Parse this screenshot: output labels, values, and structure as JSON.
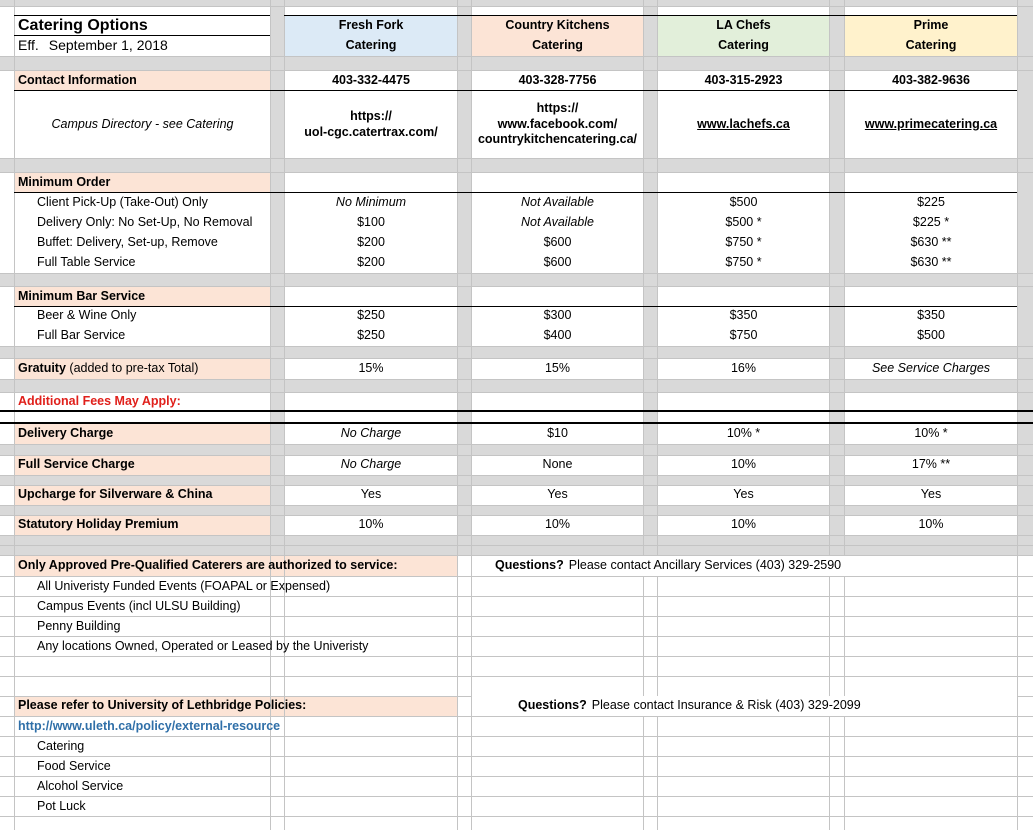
{
  "title": "Catering Options",
  "effective": {
    "label": "Eff.",
    "date": "September 1, 2018"
  },
  "vendors": [
    {
      "name": "Fresh Fork",
      "sub": "Catering"
    },
    {
      "name": "Country Kitchens",
      "sub": "Catering"
    },
    {
      "name": "LA Chefs",
      "sub": "Catering"
    },
    {
      "name": "Prime",
      "sub": "Catering"
    }
  ],
  "contact": {
    "label": "Contact Information",
    "phones": [
      "403-332-4475",
      "403-328-7756",
      "403-315-2923",
      "403-382-9636"
    ],
    "directory_note": "Campus Directory - see Catering",
    "web": {
      "fresh_fork_1": "https://",
      "fresh_fork_2": "uol-cgc.catertrax.com/",
      "country_1": "https://",
      "country_2": "www.facebook.com/",
      "country_3": "countrykitchencatering.ca/",
      "la_chefs": "www.lachefs.ca",
      "prime": "www.primecatering.ca"
    }
  },
  "minimum_order": {
    "label": "Minimum Order",
    "rows": [
      {
        "label": "Client Pick-Up (Take-Out) Only",
        "values": [
          "No Minimum",
          "Not Available",
          "$500",
          "$225"
        ]
      },
      {
        "label": "Delivery Only: No Set-Up, No Removal",
        "values": [
          "$100",
          "Not Available",
          "$500 *",
          "$225 *"
        ]
      },
      {
        "label": "Buffet: Delivery, Set-up, Remove",
        "values": [
          "$200",
          "$600",
          "$750 *",
          "$630 **"
        ]
      },
      {
        "label": "Full Table Service",
        "values": [
          "$200",
          "$600",
          "$750 *",
          "$630 **"
        ]
      }
    ]
  },
  "minimum_bar": {
    "label": "Minimum Bar Service",
    "rows": [
      {
        "label": "Beer & Wine Only",
        "values": [
          "$250",
          "$300",
          "$350",
          "$350"
        ]
      },
      {
        "label": "Full Bar Service",
        "values": [
          "$250",
          "$400",
          "$750",
          "$500"
        ]
      }
    ]
  },
  "gratuity": {
    "label_bold": "Gratuity",
    "label_rest": " (added to pre-tax Total)",
    "values": [
      "15%",
      "15%",
      "16%",
      "See Service Charges"
    ]
  },
  "additional_fees": "Additional Fees May Apply:",
  "fees": [
    {
      "label": "Delivery Charge",
      "values": [
        "No Charge",
        "$10",
        "10% *",
        "10% *"
      ]
    },
    {
      "label": "Full Service Charge",
      "values": [
        "No Charge",
        "None",
        "10%",
        "17% **"
      ]
    },
    {
      "label": "Upcharge for Silverware & China",
      "values": [
        "Yes",
        "Yes",
        "Yes",
        "Yes"
      ]
    },
    {
      "label": "Statutory Holiday Premium",
      "values": [
        "10%",
        "10%",
        "10%",
        "10%"
      ]
    }
  ],
  "approved": {
    "heading": "Only Approved Pre-Qualified Caterers are authorized to service:",
    "questions_bold": "Questions?",
    "questions_text": "Please contact Ancillary Services (403) 329-2590",
    "items": [
      "All Univeristy Funded Events (FOAPAL or Expensed)",
      "Campus Events (incl ULSU Building)",
      "Penny Building",
      "Any locations Owned, Operated or Leased by the Univeristy"
    ]
  },
  "policies": {
    "heading": "Please refer to University of Lethbridge Policies:",
    "questions_bold": "Questions?",
    "questions_text": "Please contact Insurance & Risk  (403) 329-2099",
    "link": "http://www.uleth.ca/policy/external-resource",
    "items": [
      "Catering",
      "Food Service",
      "Alcohol Service",
      "Pot Luck"
    ]
  }
}
